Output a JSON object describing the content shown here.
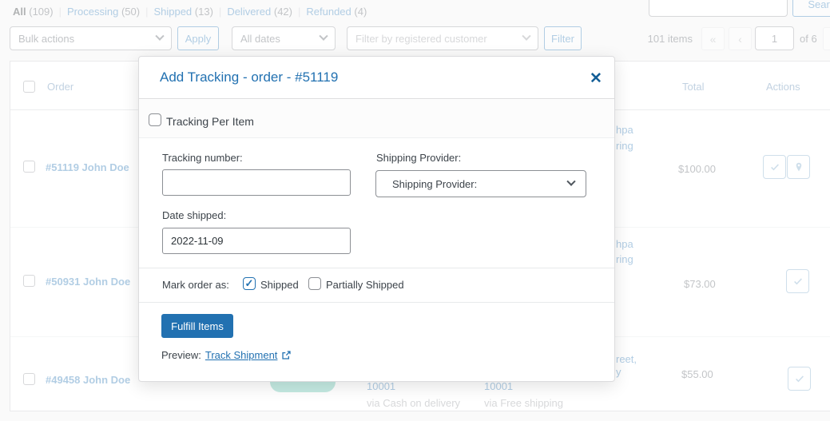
{
  "colors": {
    "accent": "#2271b1",
    "modal_title": "#2271b1",
    "close_icon": "#135e96",
    "status_badge": "#58c2ab",
    "page_background": "#f0f0f1"
  },
  "icons": {
    "close": "✕",
    "checkmark": "✓",
    "first_page": "«",
    "prev_page": "‹",
    "next_page": "›",
    "pin": "map-pin",
    "external_link": "external-link"
  },
  "filter_bar": {
    "separator": "|",
    "items": [
      {
        "label": "All",
        "count": "(109)"
      },
      {
        "label": "Processing",
        "count": "(50)"
      },
      {
        "label": "Shipped",
        "count": "(13)"
      },
      {
        "label": "Delivered",
        "count": "(42)"
      },
      {
        "label": "Refunded",
        "count": "(4)"
      }
    ]
  },
  "toolbar": {
    "bulk_actions": "Bulk actions",
    "apply": "Apply",
    "all_dates": "All dates",
    "customer_filter_placeholder": "Filter by registered customer",
    "filter": "Filter",
    "items_count": "101 items",
    "page_value": "1",
    "of_pages": "of 6",
    "search_button": "Search",
    "search_value": ""
  },
  "table": {
    "headers": {
      "order": "Order",
      "total": "Total",
      "actions": "Actions"
    },
    "rows": [
      {
        "order": "#51119 John Doe",
        "total": "$100.00",
        "frag1": "hpa",
        "frag2": "ring"
      },
      {
        "order": "#50931 John Doe",
        "total": "$73.00",
        "frag1": "hpa",
        "frag2": "ring"
      },
      {
        "order": "#49458 John Doe",
        "total": "$55.00",
        "frag1": "reet,",
        "frag2": "y",
        "tracking1": "10001",
        "via1": "via Cash on delivery",
        "tracking2": "10001",
        "via2": "via Free shipping"
      }
    ]
  },
  "modal": {
    "title": "Add Tracking - order - #51119",
    "close": "✕",
    "tracking_per_item_label": "Tracking Per Item",
    "tracking_number_label": "Tracking number:",
    "tracking_number_value": "",
    "shipping_provider_label": "Shipping Provider:",
    "shipping_provider_selected": "Shipping Provider:",
    "date_shipped_label": "Date shipped:",
    "date_shipped_value": "2022-11-09",
    "mark_order_as_label": "Mark order as:",
    "shipped_checkbox_label": "Shipped",
    "partially_shipped_checkbox_label": "Partially Shipped",
    "fulfill_button": "Fulfill Items",
    "preview_label": "Preview:",
    "preview_link": "Track Shipment"
  }
}
